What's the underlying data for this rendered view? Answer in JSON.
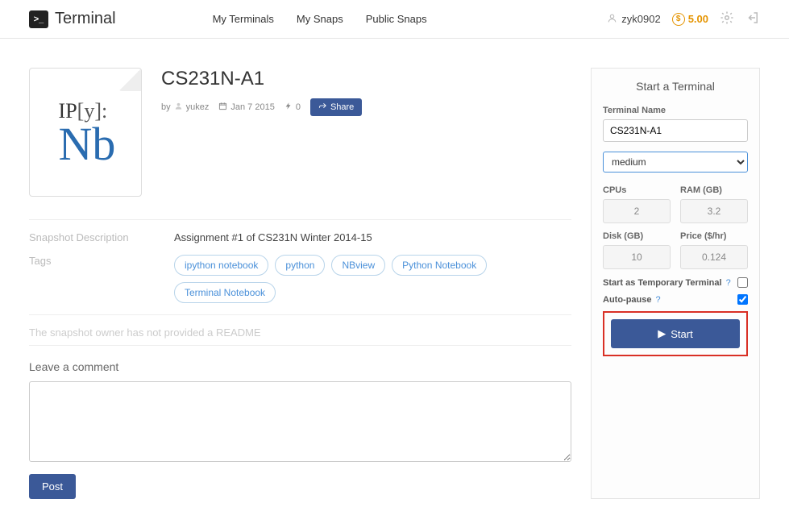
{
  "header": {
    "brand": "Terminal",
    "nav": {
      "my_terminals": "My Terminals",
      "my_snaps": "My Snaps",
      "public_snaps": "Public Snaps"
    },
    "user": "zyk0902",
    "balance": "5.00"
  },
  "snapshot": {
    "title": "CS231N-A1",
    "by_label": "by",
    "author": "yukez",
    "date": "Jan 7 2015",
    "forks": "0",
    "share_label": "Share",
    "desc_label": "Snapshot Description",
    "description": "Assignment #1 of CS231N Winter 2014-15",
    "tags_label": "Tags",
    "tags": [
      "ipython notebook",
      "python",
      "NBview",
      "Python Notebook",
      "Terminal Notebook"
    ],
    "readme_note": "The snapshot owner has not provided a README",
    "comment_heading": "Leave a comment",
    "post_label": "Post"
  },
  "sidebar": {
    "title": "Start a Terminal",
    "name_label": "Terminal Name",
    "name_value": "CS231N-A1",
    "size_selected": "medium",
    "specs": {
      "cpus_label": "CPUs",
      "cpus": "2",
      "ram_label": "RAM (GB)",
      "ram": "3.2",
      "disk_label": "Disk (GB)",
      "disk": "10",
      "price_label": "Price ($/hr)",
      "price": "0.124"
    },
    "temp_label": "Start as Temporary Terminal",
    "autopause_label": "Auto-pause",
    "start_label": "Start"
  }
}
